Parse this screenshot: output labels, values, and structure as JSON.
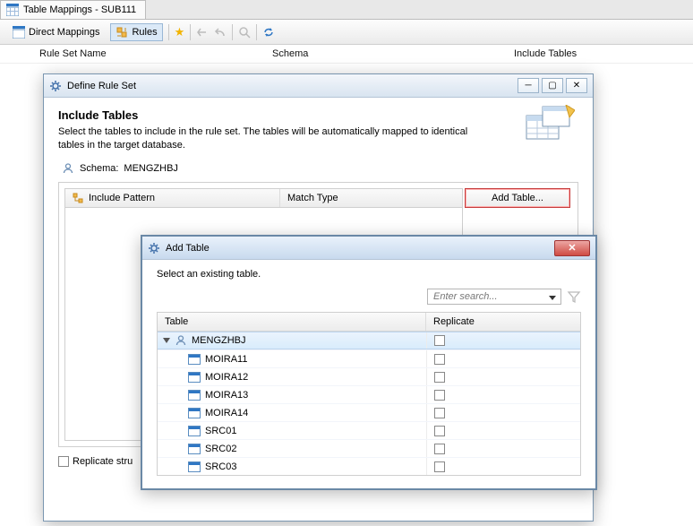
{
  "tab": {
    "title": "Table Mappings - SUB111"
  },
  "toolbar": {
    "direct_mappings": "Direct Mappings",
    "rules": "Rules"
  },
  "columns": {
    "rule_set_name": "Rule Set Name",
    "schema": "Schema",
    "include_tables": "Include Tables"
  },
  "define_dialog": {
    "title": "Define Rule Set",
    "heading": "Include Tables",
    "description": "Select the tables to include in the rule set. The tables will be automatically mapped to identical tables in the target database.",
    "schema_label": "Schema:",
    "schema_value": "MENGZHBJ",
    "include_pattern": "Include Pattern",
    "match_type": "Match Type",
    "add_table_btn": "Add Table...",
    "replicate_checkbox": "Replicate stru"
  },
  "add_table_dialog": {
    "title": "Add Table",
    "instruction": "Select an existing table.",
    "search_placeholder": "Enter search...",
    "col_table": "Table",
    "col_replicate": "Replicate",
    "root_schema": "MENGZHBJ",
    "tables": [
      {
        "name": "MOIRA11"
      },
      {
        "name": "MOIRA12"
      },
      {
        "name": "MOIRA13"
      },
      {
        "name": "MOIRA14"
      },
      {
        "name": "SRC01"
      },
      {
        "name": "SRC02"
      },
      {
        "name": "SRC03"
      }
    ]
  }
}
